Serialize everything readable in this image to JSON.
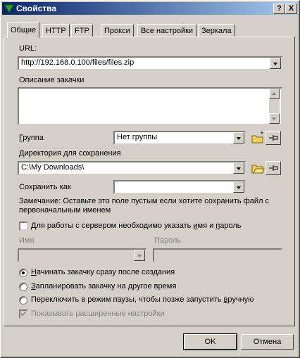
{
  "window": {
    "title": "Свойства",
    "help_label": "?",
    "close_label": "X"
  },
  "tabs": [
    {
      "label": "Общие"
    },
    {
      "label": "HTTP"
    },
    {
      "label": "FTP"
    },
    {
      "label": "Прокси"
    },
    {
      "label": "Все настройки"
    },
    {
      "label": "Зеркала"
    }
  ],
  "url": {
    "label": "URL:",
    "value": "http://192.168.0.100/files/files.zip"
  },
  "description": {
    "label": "Описание закачки",
    "value": ""
  },
  "group": {
    "label_first": "Г",
    "label_rest": "руппа",
    "value": "Нет группы"
  },
  "save_dir": {
    "label": "Директория для сохранения",
    "value": "C:\\My Downloads\\"
  },
  "save_as": {
    "label": "Сохранить как",
    "value": ""
  },
  "note": {
    "line1": "Замечание: Оставьте это поле пустым если хотите сохранить файл с",
    "line2": "первоначальным именем"
  },
  "auth": {
    "label_pre": "Д",
    "label_mid": "ля работы с сервером необходимо указать ",
    "label_u": "и",
    "label_post": "мя и ",
    "label_u2": "п",
    "label_end": "ароль"
  },
  "username": {
    "label": "Имя",
    "value": ""
  },
  "password": {
    "label": "Пароль",
    "value": ""
  },
  "start_options": [
    {
      "u": "Н",
      "rest": "ачинать закачку сразу после создания",
      "selected": true
    },
    {
      "u": "З",
      "rest": "апланировать закачку на другое время",
      "selected": false
    },
    {
      "pre": "Переключить в режим паузы, чтобы позже запустить ",
      "u": "в",
      "rest": "ручную",
      "selected": false
    }
  ],
  "advanced": {
    "label": "Показывать расширенные настройки"
  },
  "buttons": {
    "ok": "OK",
    "cancel": "Отмена"
  },
  "colors": {
    "title_start": "#0a246a",
    "title_end": "#a6caf0",
    "face": "#d4d0c8"
  }
}
